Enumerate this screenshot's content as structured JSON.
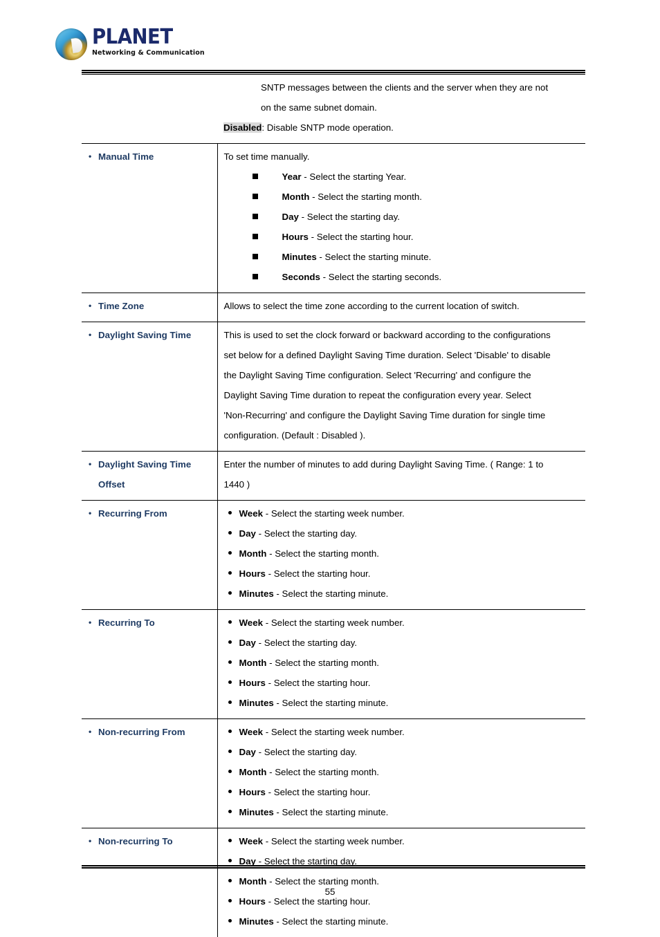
{
  "brand": {
    "name": "PLANET",
    "tagline": "Networking & Communication",
    "logo_icon": "planet-globe-logo",
    "brand_color": "#1b2a6b"
  },
  "theme": {
    "label_color": "#1f3b63",
    "highlight_color": "#d9d9d9",
    "rule_color": "#000000"
  },
  "footer": {
    "page_number": "55"
  },
  "table": {
    "rows": [
      {
        "id": "sntp-continued",
        "label_lines": [],
        "has_bullet_label": false,
        "desc_type": "paragraph-continued",
        "paragraph_indented": [
          "SNTP messages between the clients and the server when they are not",
          "on the same subnet domain."
        ],
        "highlight_term": "Disabled",
        "highlight_rest": ": Disable SNTP mode operation."
      },
      {
        "id": "manual-time",
        "label_lines": [
          "Manual Time"
        ],
        "has_bullet_label": true,
        "desc_type": "intro-square-list",
        "intro": "To set time manually.",
        "bullet_style": "square",
        "items": [
          {
            "term": "Year",
            "rest": " - Select the starting Year."
          },
          {
            "term": "Month",
            "rest": " - Select the starting month."
          },
          {
            "term": "Day",
            "rest": " - Select the starting day."
          },
          {
            "term": "Hours",
            "rest": " - Select the starting hour."
          },
          {
            "term": "Minutes",
            "rest": " - Select the starting minute."
          },
          {
            "term": "Seconds",
            "rest": " - Select the starting seconds."
          }
        ]
      },
      {
        "id": "time-zone",
        "label_lines": [
          "Time Zone"
        ],
        "has_bullet_label": true,
        "desc_type": "paragraph",
        "paragraph": [
          "Allows to select the time zone according to the current location of switch."
        ]
      },
      {
        "id": "daylight-saving-time",
        "label_lines": [
          "Daylight Saving Time"
        ],
        "has_bullet_label": true,
        "desc_type": "paragraph",
        "paragraph": [
          "This is used to set the clock forward or backward according to the configurations",
          "set below for a defined Daylight Saving Time duration. Select 'Disable' to disable",
          "the Daylight Saving Time configuration. Select 'Recurring' and configure the",
          "Daylight Saving Time duration to repeat the configuration every year. Select",
          "'Non-Recurring' and configure the Daylight Saving Time duration for single time",
          "configuration. (Default : Disabled )."
        ]
      },
      {
        "id": "daylight-saving-time-offset",
        "label_lines": [
          "Daylight Saving Time",
          "Offset"
        ],
        "has_bullet_label": true,
        "desc_type": "paragraph",
        "paragraph": [
          "Enter the number of minutes to add during Daylight Saving Time. ( Range: 1 to",
          "1440 )"
        ]
      },
      {
        "id": "recurring-from",
        "label_lines": [
          "Recurring From"
        ],
        "has_bullet_label": true,
        "desc_type": "round-list",
        "bullet_style": "round",
        "items": [
          {
            "term": "Week",
            "rest": " - Select the starting week number."
          },
          {
            "term": "Day",
            "rest": " - Select the starting day."
          },
          {
            "term": "Month",
            "rest": " - Select the starting month."
          },
          {
            "term": "Hours",
            "rest": " - Select the starting hour."
          },
          {
            "term": "Minutes",
            "rest": " - Select the starting minute."
          }
        ]
      },
      {
        "id": "recurring-to",
        "label_lines": [
          "Recurring To"
        ],
        "has_bullet_label": true,
        "desc_type": "round-list",
        "bullet_style": "round",
        "items": [
          {
            "term": "Week",
            "rest": " - Select the starting week number."
          },
          {
            "term": "Day",
            "rest": " - Select the starting day."
          },
          {
            "term": "Month",
            "rest": " - Select the starting month."
          },
          {
            "term": "Hours",
            "rest": " - Select the starting hour."
          },
          {
            "term": "Minutes",
            "rest": " - Select the starting minute."
          }
        ]
      },
      {
        "id": "non-recurring-from",
        "label_lines": [
          "Non-recurring From"
        ],
        "has_bullet_label": true,
        "desc_type": "round-list",
        "bullet_style": "round",
        "items": [
          {
            "term": "Week",
            "rest": " - Select the starting week number."
          },
          {
            "term": "Day",
            "rest": " - Select the starting day."
          },
          {
            "term": "Month",
            "rest": " - Select the starting month."
          },
          {
            "term": "Hours",
            "rest": " - Select the starting hour."
          },
          {
            "term": "Minutes",
            "rest": " - Select the starting minute."
          }
        ]
      },
      {
        "id": "non-recurring-to",
        "label_lines": [
          "Non-recurring To"
        ],
        "has_bullet_label": true,
        "desc_type": "round-list",
        "bullet_style": "round",
        "items": [
          {
            "term": "Week",
            "rest": " - Select the starting week number."
          },
          {
            "term": "Day",
            "rest": " - Select the starting day."
          },
          {
            "term": "Month",
            "rest": " - Select the starting month."
          },
          {
            "term": "Hours",
            "rest": " - Select the starting hour."
          },
          {
            "term": "Minutes",
            "rest": " - Select the starting minute."
          }
        ]
      }
    ]
  }
}
